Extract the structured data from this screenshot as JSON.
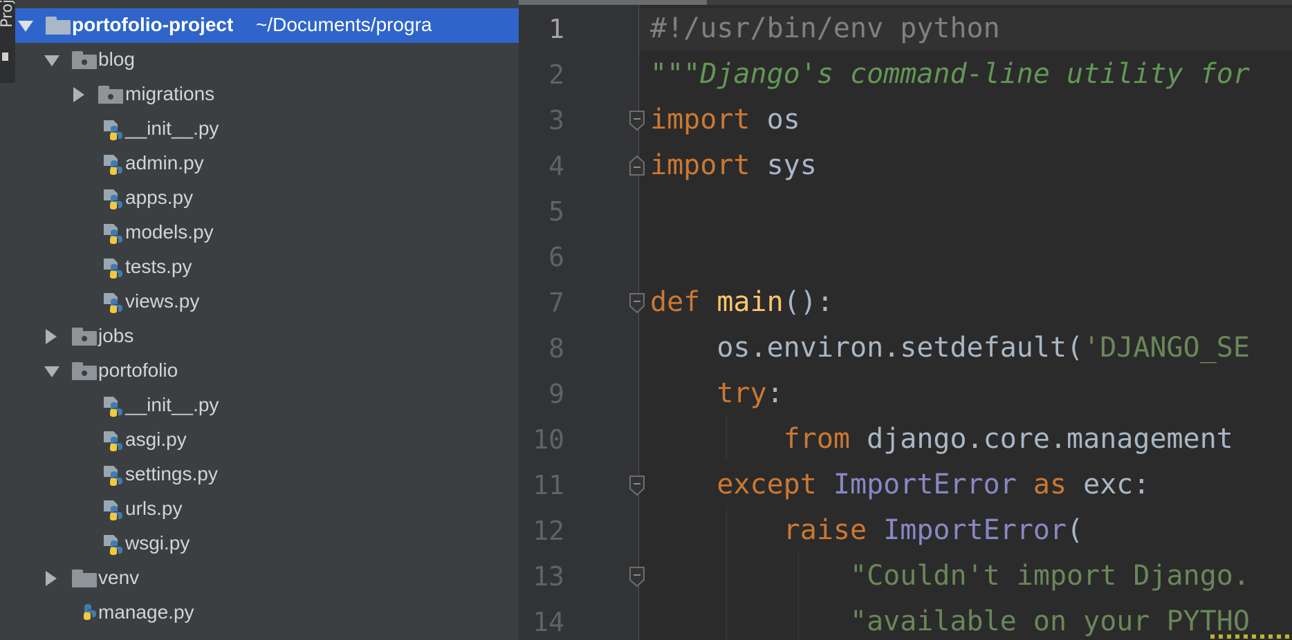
{
  "tool_stripe": {
    "label": "Proje"
  },
  "tree": {
    "root": {
      "name": "portofolio-project",
      "path": "~/Documents/progra"
    },
    "items": [
      {
        "label": "blog"
      },
      {
        "label": "migrations"
      },
      {
        "label": "__init__.py"
      },
      {
        "label": "admin.py"
      },
      {
        "label": "apps.py"
      },
      {
        "label": "models.py"
      },
      {
        "label": "tests.py"
      },
      {
        "label": "views.py"
      },
      {
        "label": "jobs"
      },
      {
        "label": "portofolio"
      },
      {
        "label": "__init__.py"
      },
      {
        "label": "asgi.py"
      },
      {
        "label": "settings.py"
      },
      {
        "label": "urls.py"
      },
      {
        "label": "wsgi.py"
      },
      {
        "label": "venv"
      },
      {
        "label": "manage.py"
      }
    ]
  },
  "editor": {
    "line_numbers": [
      "1",
      "2",
      "3",
      "4",
      "5",
      "6",
      "7",
      "8",
      "9",
      "10",
      "11",
      "12",
      "13",
      "14"
    ],
    "current_line": 1,
    "lines": [
      {
        "t": "#!/usr/bin/env python"
      },
      {
        "t": "\"\"\"Django's command-line utility for"
      },
      {
        "kw": "import",
        "rest": " os"
      },
      {
        "kw": "import",
        "rest": " sys"
      },
      {
        "t": ""
      },
      {
        "t": ""
      },
      {
        "kw": "def",
        "fn": " main",
        "rest": "():"
      },
      {
        "a": "    os.environ.setdefault(",
        "s": "'DJANGO_SE"
      },
      {
        "kw": "    try",
        "rest": ":"
      },
      {
        "kw": "        from",
        "rest": " django.core.management"
      },
      {
        "kw": "    except",
        "cls": " ImportError",
        "kw2": " as",
        "rest": " exc:"
      },
      {
        "kw": "        raise",
        "cls": " ImportError",
        "rest": "("
      },
      {
        "s": "            \"Couldn't import Django."
      },
      {
        "s": "            \"available on your PYTHO"
      }
    ]
  },
  "colors": {
    "keyword": "#cc7832",
    "string": "#6a8759",
    "comment": "#808080",
    "docstring": "#629755",
    "function": "#ffc66d",
    "class": "#8888c6",
    "text": "#a9b7c6",
    "selection": "#2f65ca"
  }
}
